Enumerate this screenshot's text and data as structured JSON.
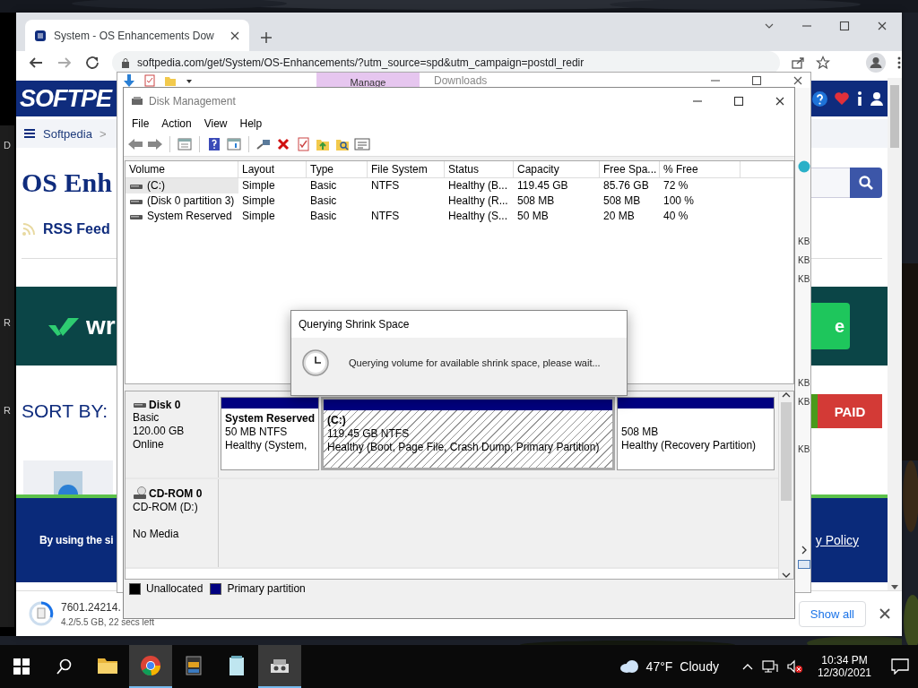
{
  "edge_window": {
    "letters": [
      "D",
      "R",
      "R"
    ]
  },
  "browser": {
    "tab": {
      "title": "System - OS Enhancements Dow",
      "selected": true
    },
    "url": "softpedia.com/get/System/OS-Enhancements/?utm_source=spd&utm_campaign=postdl_redir",
    "page": {
      "logo": "SOFTPE",
      "breadcrumb": [
        "Softpedia",
        ">"
      ],
      "heading": "OS Enh",
      "rss": "RSS Feed",
      "banner_text": "wr",
      "banner_button": "e",
      "sort_label": "SORT BY:",
      "paid_button": "PAID",
      "cookie_text": "By using the si",
      "cookie_link": "y Policy"
    },
    "download": {
      "file": "7601.24214.",
      "progress": "4.2/5.5 GB, 22 secs left",
      "show_all": "Show all"
    }
  },
  "explorer": {
    "ribbon_tab": "Manage",
    "title": "Downloads",
    "sizes": [
      "KB",
      "KB",
      "KB",
      "KB",
      "KB",
      "KB"
    ]
  },
  "disk_management": {
    "title": "Disk Management",
    "menu": [
      "File",
      "Action",
      "View",
      "Help"
    ],
    "columns": [
      "Volume",
      "Layout",
      "Type",
      "File System",
      "Status",
      "Capacity",
      "Free Spa...",
      "% Free"
    ],
    "volumes": [
      {
        "volume": "(C:)",
        "layout": "Simple",
        "type": "Basic",
        "file_system": "NTFS",
        "status": "Healthy (B...",
        "capacity": "119.45 GB",
        "free_space": "85.76 GB",
        "percent_free": "72 %",
        "selected": true
      },
      {
        "volume": "(Disk 0 partition 3)",
        "layout": "Simple",
        "type": "Basic",
        "status": "Healthy (R...",
        "capacity": "508 MB",
        "free_space": "508 MB",
        "percent_free": "100 %",
        "selected": false
      },
      {
        "volume": "System Reserved",
        "layout": "Simple",
        "type": "Basic",
        "file_system": "NTFS",
        "status": "Healthy (S...",
        "capacity": "50 MB",
        "free_space": "20 MB",
        "percent_free": "40 %",
        "selected": false
      }
    ],
    "disks": [
      {
        "kind": "disk",
        "name": "Disk 0",
        "details": [
          "Basic",
          "120.00 GB",
          "Online"
        ],
        "partitions": [
          {
            "name": "System Reserved",
            "size": "50 MB NTFS",
            "status": "Healthy (System,",
            "selected": false
          },
          {
            "name": "(C:)",
            "size": "119.45 GB NTFS",
            "status": "Healthy (Boot, Page File, Crash Dump, Primary Partition)",
            "selected": true
          },
          {
            "size": "508 MB",
            "status": "Healthy (Recovery Partition)",
            "selected": false
          }
        ]
      },
      {
        "kind": "cdrom",
        "name": "CD-ROM 0",
        "details": [
          "CD-ROM (D:)",
          "No Media"
        ]
      }
    ],
    "legend": [
      {
        "label": "Unallocated",
        "color": "#000000"
      },
      {
        "label": "Primary partition",
        "color": "#000080"
      }
    ]
  },
  "dialog": {
    "title": "Querying Shrink Space",
    "message": "Querying volume for available shrink space, please wait..."
  },
  "taskbar": {
    "apps": [
      {
        "kind": "folder",
        "active": false
      },
      {
        "kind": "chrome",
        "active": true
      },
      {
        "kind": "media",
        "active": false
      },
      {
        "kind": "notepad",
        "active": false
      },
      {
        "kind": "disk",
        "active": true
      }
    ],
    "weather": {
      "temp": "47°F",
      "condition": "Cloudy"
    },
    "clock": {
      "time": "10:34 PM",
      "date": "12/30/2021"
    }
  }
}
